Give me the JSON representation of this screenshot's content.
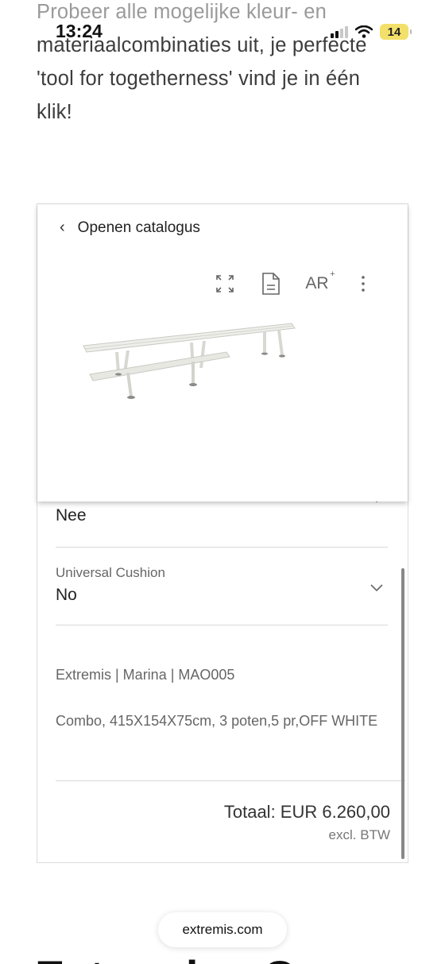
{
  "status_bar": {
    "time": "13:24",
    "battery": "14"
  },
  "intro": {
    "line1": "Probeer alle mogelijke kleur- en",
    "line2": "materiaalcombinaties uit, je perfecte",
    "line3": "'tool for togetherness' vind je in één",
    "line4": "klik!"
  },
  "viewer": {
    "back_label": "Openen catalogus",
    "tools": {
      "expand_icon": "expand-icon",
      "document_icon": "document-icon",
      "ar_label": "AR",
      "ar_plus": "+",
      "more_icon": "more-vertical-icon"
    }
  },
  "config": {
    "options": [
      {
        "label": "",
        "value": "Nee"
      },
      {
        "label": "Universal Cushion",
        "value": "No"
      }
    ],
    "product_line": "Extremis | Marina | MAO005",
    "description": "Combo, 415X154X75cm, 3 poten,5 pr,OFF WHITE",
    "total": "Totaal: EUR 6.260,00",
    "vat_note": "excl. BTW"
  },
  "browser": {
    "url": "extremis.com"
  },
  "next_section": {
    "heading": "Extremis - Over"
  }
}
